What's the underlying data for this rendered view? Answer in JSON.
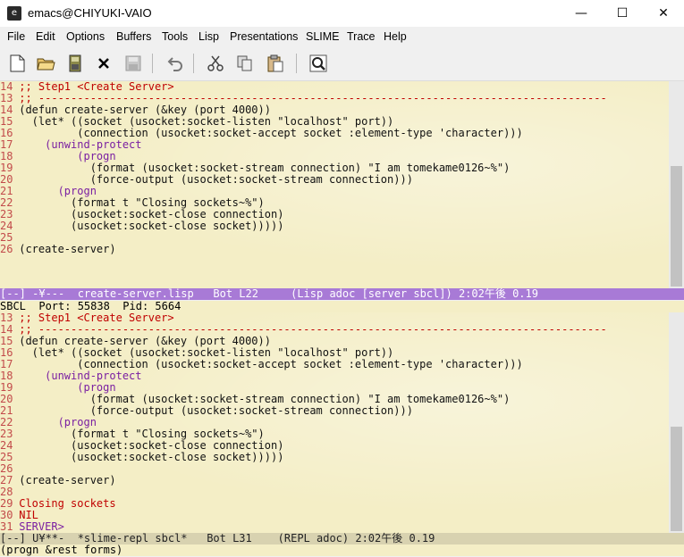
{
  "window": {
    "title": "emacs@CHIYUKI-VAIO",
    "controls": [
      "—",
      "☐",
      "✕"
    ]
  },
  "menu": [
    "File",
    "Edit",
    "Options",
    "Buffers",
    "Tools",
    "Lisp",
    "Presentations",
    "SLIME",
    "Trace",
    "Help"
  ],
  "toolbar": {
    "icons": [
      "new-file-icon",
      "open-folder-icon",
      "save-icon",
      "close-icon",
      "save-disabled-icon",
      "undo-icon",
      "cut-icon",
      "copy-icon",
      "paste-icon",
      "search-icon"
    ]
  },
  "upper_pane": {
    "lines": [
      {
        "n": "14",
        "t": " ;; Step1 <Create Server>"
      },
      {
        "n": "13",
        "t": " ;; ----------------------------------------------------------------------------------------"
      },
      {
        "n": "14",
        "t": " (defun create-server (&key (port 4000))"
      },
      {
        "n": "15",
        "t": "   (let* ((socket (usocket:socket-listen \"localhost\" port))"
      },
      {
        "n": "16",
        "t": "          (connection (usocket:socket-accept socket :element-type 'character)))"
      },
      {
        "n": "17",
        "t": "     (unwind-protect"
      },
      {
        "n": "18",
        "t": "          (progn"
      },
      {
        "n": "19",
        "t": "            (format (usocket:socket-stream connection) \"I am tomekame0126~%\")"
      },
      {
        "n": "20",
        "t": "            (force-output (usocket:socket-stream connection)))"
      },
      {
        "n": "21",
        "t": "       (progn"
      },
      {
        "n": "22",
        "t": "         (format t \"Closing sockets~%\")"
      },
      {
        "n": "23",
        "t": "         (usocket:socket-close connection)"
      },
      {
        "n": "24",
        "t": "         (usocket:socket-close socket)))))"
      },
      {
        "n": "25",
        "t": ""
      },
      {
        "n": "26",
        "t": " (create-server)"
      }
    ],
    "modeline": "[--] -¥---  create-server.lisp   Bot L22     (Lisp adoc [server sbcl]) 2:02午後 0.19"
  },
  "sbcl_header": "SBCL  Port: 55838  Pid: 5664",
  "lower_pane": {
    "lines": [
      {
        "n": "13",
        "t": " ;; Step1 <Create Server>"
      },
      {
        "n": "14",
        "t": " ;; ----------------------------------------------------------------------------------------"
      },
      {
        "n": "15",
        "t": " (defun create-server (&key (port 4000))"
      },
      {
        "n": "16",
        "t": "   (let* ((socket (usocket:socket-listen \"localhost\" port))"
      },
      {
        "n": "17",
        "t": "          (connection (usocket:socket-accept socket :element-type 'character)))"
      },
      {
        "n": "18",
        "t": "     (unwind-protect"
      },
      {
        "n": "19",
        "t": "          (progn"
      },
      {
        "n": "20",
        "t": "            (format (usocket:socket-stream connection) \"I am tomekame0126~%\")"
      },
      {
        "n": "21",
        "t": "            (force-output (usocket:socket-stream connection)))"
      },
      {
        "n": "22",
        "t": "       (progn"
      },
      {
        "n": "23",
        "t": "         (format t \"Closing sockets~%\")"
      },
      {
        "n": "24",
        "t": "         (usocket:socket-close connection)"
      },
      {
        "n": "25",
        "t": "         (usocket:socket-close socket)))))"
      },
      {
        "n": "26",
        "t": ""
      },
      {
        "n": "27",
        "t": " (create-server)"
      },
      {
        "n": "28",
        "t": ""
      },
      {
        "n": "29",
        "t": " Closing sockets"
      },
      {
        "n": "30",
        "t": " NIL"
      },
      {
        "n": "31",
        "t": " SERVER>"
      }
    ],
    "modeline": "[--] U¥**-  *slime-repl sbcl*   Bot L31    (REPL adoc) 2:02午後 0.19"
  },
  "echo_area": "(progn &rest forms)",
  "colors": {
    "editor_bg": "#f4eec6",
    "active_modeline": "#a87ad6",
    "comment": "#c00000",
    "keyword": "#7a1fa2",
    "function_name": "#2030b0",
    "line_number": "#c24a4a"
  }
}
